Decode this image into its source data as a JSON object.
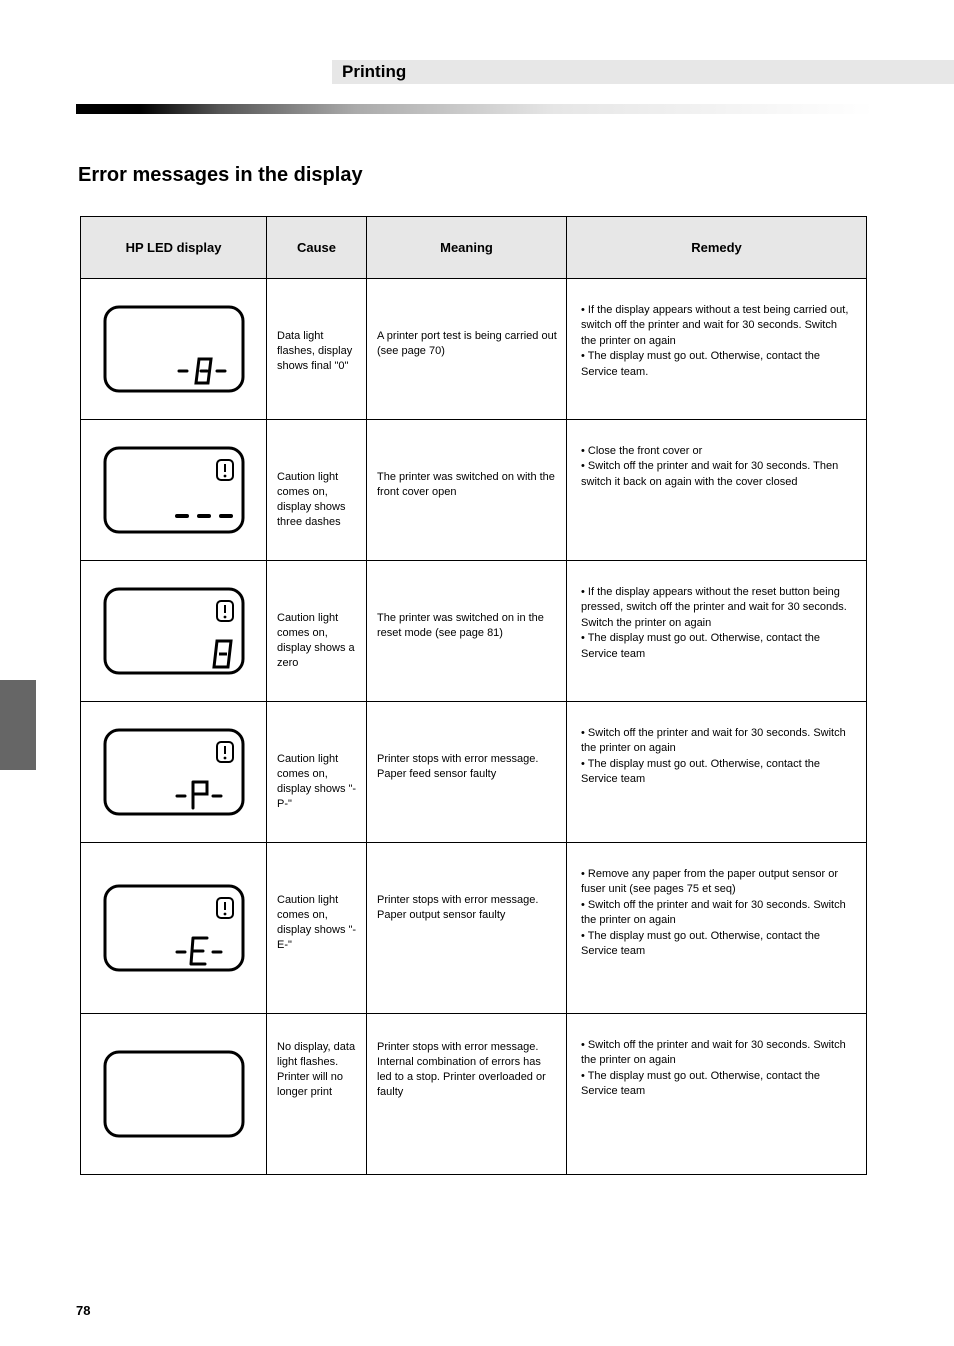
{
  "header": {
    "top_label": "Printing",
    "section_title": "Error messages in the display"
  },
  "table": {
    "headers": {
      "display": "HP LED display",
      "cause": "Cause",
      "meaning": "Meaning",
      "remedy": "Remedy"
    },
    "rows": [
      {
        "cause": "Data light flashes, display shows final \"0\"",
        "meaning": "A printer port test is being carried out (see page 70)",
        "remedy": "• If the display appears without a test being carried out, switch off the printer and wait for 30 seconds. Switch the printer on again\n• The display must go out. Otherwise, contact the Service team."
      },
      {
        "cause": "Caution light comes on, display shows three dashes",
        "meaning": "The printer was switched on with the front cover open",
        "remedy": "• Close the front cover or\n• Switch off the printer and wait for 30 seconds. Then switch it back on again with the cover closed"
      },
      {
        "cause": "Caution light comes on, display shows a zero",
        "meaning": "The printer was switched on in the reset mode (see page 81)",
        "remedy": "• If the display appears without the reset button being pressed, switch off the printer and wait for 30 seconds. Switch the printer on again\n• The display must go out. Otherwise, contact the Service team"
      },
      {
        "cause": "Caution light comes on, display shows \"-P-\"",
        "meaning": "Printer stops with error message. Paper feed sensor faulty",
        "remedy": "• Switch off the printer and wait for 30 seconds. Switch the printer on again\n• The display must go out. Otherwise, contact the Service team"
      },
      {
        "cause": "Caution light comes on, display shows \"-E-\"",
        "meaning": "Printer stops with error message. Paper output sensor faulty",
        "remedy": "• Remove any paper from the paper output sensor or fuser unit (see pages 75 et seq)\n• Switch off the printer and wait for 30 seconds. Switch the printer on again\n• The display must go out. Otherwise, contact the Service team"
      },
      {
        "cause": "No display, data light flashes. Printer will no longer print",
        "meaning": "Printer stops with error message. Internal combination of errors has led to a stop. Printer overloaded or faulty",
        "remedy": "• Switch off the printer and wait for 30 seconds. Switch the printer on again\n• The display must go out. Otherwise, contact the Service team"
      }
    ]
  },
  "footer": {
    "page_number": "78"
  }
}
